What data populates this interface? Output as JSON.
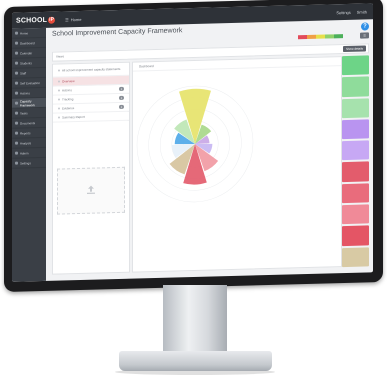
{
  "topbar": {
    "logo": "SCHOOL",
    "logo_mark": "iP",
    "menu_label": "Home",
    "user_links": [
      "Settings",
      "Smith"
    ]
  },
  "sidebar": {
    "items": [
      {
        "label": "Home"
      },
      {
        "label": "Dashboard"
      },
      {
        "label": "Calendar"
      },
      {
        "label": "Students"
      },
      {
        "label": "Staff"
      },
      {
        "label": "Self Evaluation"
      },
      {
        "label": "Actions"
      },
      {
        "label": "Capacity Framework"
      },
      {
        "label": "Tasks"
      },
      {
        "label": "Documents"
      },
      {
        "label": "Reports"
      },
      {
        "label": "Analysis"
      },
      {
        "label": "Admin"
      },
      {
        "label": "Settings"
      }
    ]
  },
  "page": {
    "title": "School Improvement Capacity Framework",
    "help": "?"
  },
  "toolbar": {
    "label": "Views",
    "button": "Show details"
  },
  "left_panel": {
    "items": [
      {
        "label": "All school improvement capacity statements",
        "count": "",
        "selected": false
      },
      {
        "label": "Overview",
        "count": "",
        "selected": true
      },
      {
        "label": "Actions",
        "count": "1",
        "selected": false
      },
      {
        "label": "Tracking",
        "count": "1",
        "selected": false
      },
      {
        "label": "Evidence",
        "count": "1",
        "selected": false
      },
      {
        "label": "Summary Report",
        "count": "",
        "selected": false
      }
    ]
  },
  "chart_panel": {
    "header": "Dashboard"
  },
  "colors": {
    "topbar": "#2e3238",
    "sidebar": "#3a3f46",
    "accent": "#2f8fe6",
    "legend": [
      "#e24b5b",
      "#f0a046",
      "#e7e04a",
      "#8fd16a",
      "#4cb05a"
    ]
  },
  "chart_data": {
    "type": "polar-area",
    "r_max": 10,
    "segments": [
      {
        "label": "",
        "value": 9.5,
        "color": "#e6e36a"
      },
      {
        "label": "",
        "value": 3.5,
        "color": "#a8d88a"
      },
      {
        "label": "",
        "value": 2.5,
        "color": "#c9a7e6"
      },
      {
        "label": "",
        "value": 3.0,
        "color": "#c7b6f2"
      },
      {
        "label": "",
        "value": 5.0,
        "color": "#f19aa3"
      },
      {
        "label": "",
        "value": 7.0,
        "color": "#e35c6c"
      },
      {
        "label": "",
        "value": 5.5,
        "color": "#d6c39c"
      },
      {
        "label": "",
        "value": 4.0,
        "color": "#e6f0f8"
      },
      {
        "label": "",
        "value": 3.5,
        "color": "#4fa8e8"
      },
      {
        "label": "",
        "value": 4.5,
        "color": "#bde6b4"
      }
    ]
  },
  "cards": [
    {
      "color": "#6dd487"
    },
    {
      "color": "#8fdc9b"
    },
    {
      "color": "#a6e2ad"
    },
    {
      "color": "#b994f0"
    },
    {
      "color": "#c7a8f4"
    },
    {
      "color": "#e35c6c"
    },
    {
      "color": "#e96c7c"
    },
    {
      "color": "#f08a98"
    },
    {
      "color": "#e45565"
    },
    {
      "color": "#d8caa4"
    }
  ]
}
